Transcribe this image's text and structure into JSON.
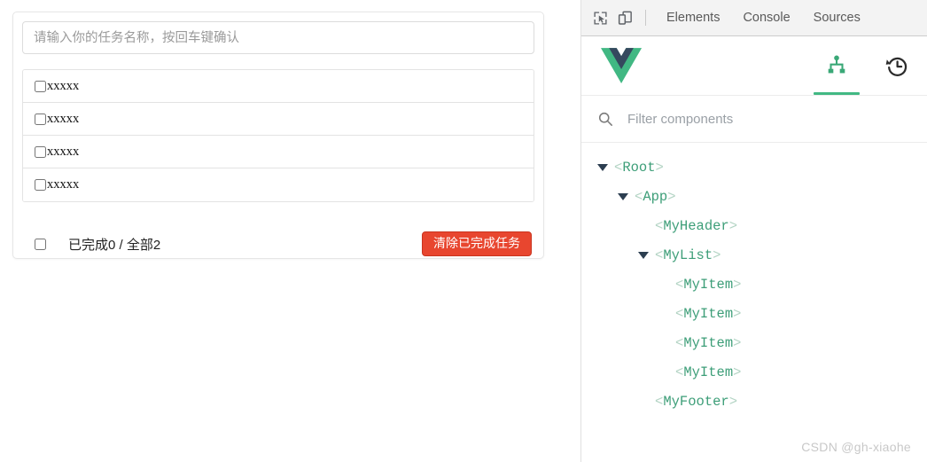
{
  "todo_app": {
    "input": {
      "placeholder": "请输入你的任务名称，按回车键确认",
      "value": ""
    },
    "items": [
      {
        "label": "xxxxx",
        "checked": false
      },
      {
        "label": "xxxxx",
        "checked": false
      },
      {
        "label": "xxxxx",
        "checked": false
      },
      {
        "label": "xxxxx",
        "checked": false
      }
    ],
    "footer": {
      "select_all_checked": false,
      "count_text": "已完成0 / 全部2",
      "clear_button_label": "清除已完成任务",
      "clear_button_color": "#e8462f"
    }
  },
  "devtools": {
    "toolbar": {
      "inspect_icon": "inspect-element-icon",
      "device_icon": "device-toolbar-icon",
      "tabs": [
        {
          "label": "Elements",
          "active": false
        },
        {
          "label": "Console",
          "active": false
        },
        {
          "label": "Sources",
          "active": false
        }
      ]
    },
    "vue_panel": {
      "logo": "vue-logo",
      "logo_colors": {
        "outer": "#41b883",
        "inner": "#35495e"
      },
      "accent_color": "#42b883",
      "tabs": [
        {
          "icon": "component-tree-icon",
          "active": true
        },
        {
          "icon": "timeline-history-icon",
          "active": false
        }
      ],
      "filter": {
        "icon": "search-icon",
        "placeholder": "Filter components",
        "value": ""
      },
      "tree": [
        {
          "name": "Root",
          "depth": 0,
          "expandable": true,
          "expanded": true
        },
        {
          "name": "App",
          "depth": 1,
          "expandable": true,
          "expanded": true
        },
        {
          "name": "MyHeader",
          "depth": 2,
          "expandable": false,
          "expanded": false
        },
        {
          "name": "MyList",
          "depth": 2,
          "expandable": true,
          "expanded": true
        },
        {
          "name": "MyItem",
          "depth": 3,
          "expandable": false,
          "expanded": false
        },
        {
          "name": "MyItem",
          "depth": 3,
          "expandable": false,
          "expanded": false
        },
        {
          "name": "MyItem",
          "depth": 3,
          "expandable": false,
          "expanded": false
        },
        {
          "name": "MyItem",
          "depth": 3,
          "expandable": false,
          "expanded": false
        },
        {
          "name": "MyFooter",
          "depth": 2,
          "expandable": false,
          "expanded": false
        }
      ]
    }
  },
  "watermark": "CSDN @gh-xiaohe"
}
